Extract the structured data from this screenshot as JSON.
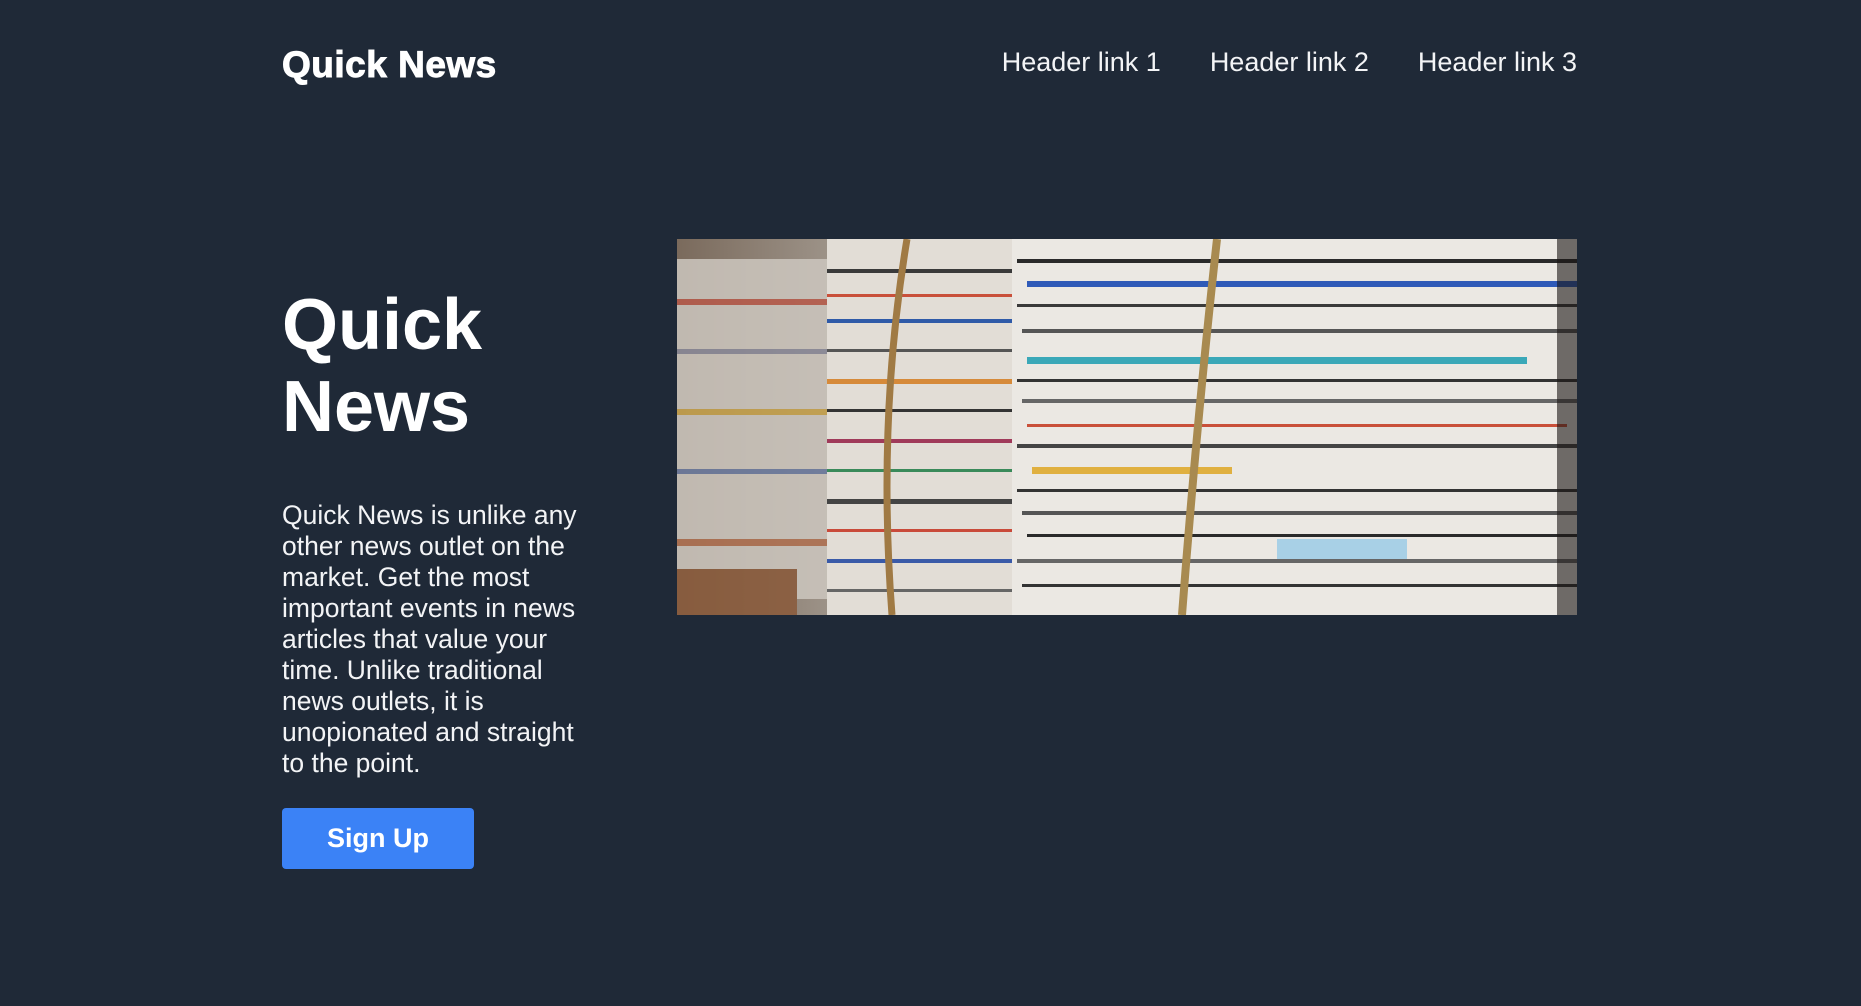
{
  "header": {
    "logo": "Quick News",
    "links": [
      "Header link 1",
      "Header link 2",
      "Header link 3"
    ]
  },
  "hero": {
    "title": "Quick News",
    "description": "Quick News is unlike any other news outlet on the market. Get the most important events in news articles that value your time. Unlike traditional news outlets, it is unopionated and straight to the point.",
    "button_label": "Sign Up",
    "image_subject": "stacked-newspapers-image"
  },
  "colors": {
    "background": "#1f2937",
    "text": "#f3f4f6",
    "button": "#3b82f6"
  }
}
